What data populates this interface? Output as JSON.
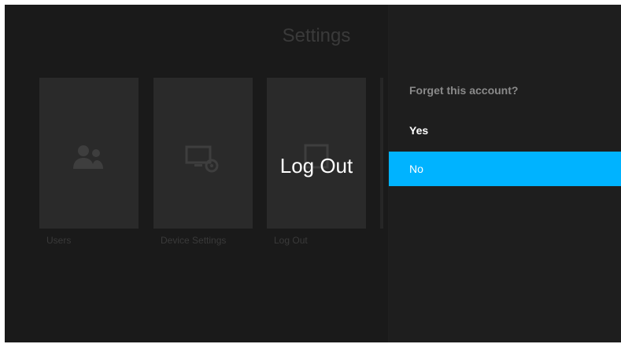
{
  "screen": {
    "title": "Settings"
  },
  "tiles": [
    {
      "label": "Users",
      "icon": "users-icon"
    },
    {
      "label": "Device Settings",
      "icon": "device-settings-icon"
    },
    {
      "label": "Log Out",
      "icon": "log-out-icon"
    }
  ],
  "focused_tile": {
    "label": "Log Out"
  },
  "dialog": {
    "title": "Forget this account?",
    "options": [
      {
        "label": "Yes"
      },
      {
        "label": "No"
      }
    ],
    "selected_option": "No"
  },
  "colors": {
    "background": "#1a1a1a",
    "tile": "#2a2a2a",
    "panel": "#1e1e1e",
    "accent": "#00b3ff"
  }
}
